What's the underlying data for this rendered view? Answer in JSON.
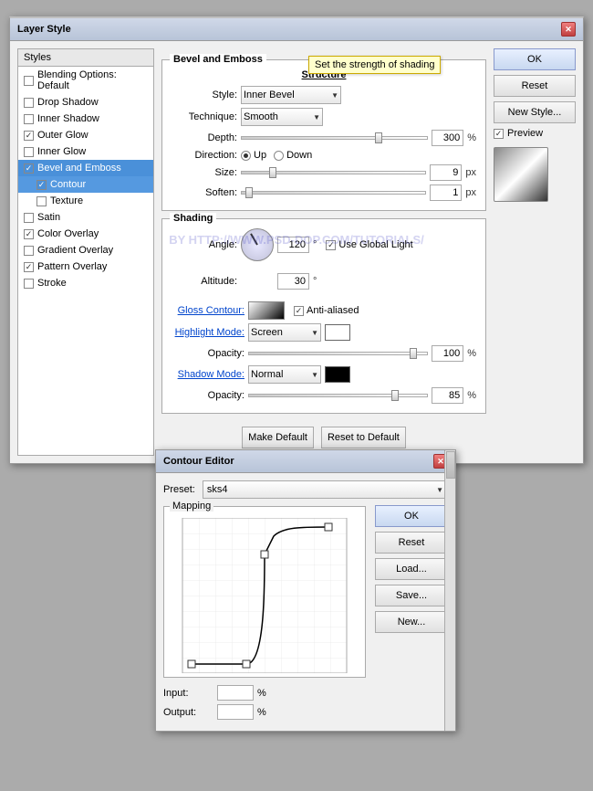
{
  "layerStyleDialog": {
    "title": "Layer Style",
    "leftPanel": {
      "header": "Styles",
      "items": [
        {
          "label": "Blending Options: Default",
          "checked": false,
          "active": false,
          "sub": false
        },
        {
          "label": "Drop Shadow",
          "checked": false,
          "active": false,
          "sub": false
        },
        {
          "label": "Inner Shadow",
          "checked": false,
          "active": false,
          "sub": false
        },
        {
          "label": "Outer Glow",
          "checked": true,
          "active": false,
          "sub": false
        },
        {
          "label": "Inner Glow",
          "checked": false,
          "active": false,
          "sub": false
        },
        {
          "label": "Bevel and Emboss",
          "checked": true,
          "active": true,
          "sub": false
        },
        {
          "label": "Contour",
          "checked": true,
          "active": true,
          "sub": true
        },
        {
          "label": "Texture",
          "checked": false,
          "active": false,
          "sub": true
        },
        {
          "label": "Satin",
          "checked": false,
          "active": false,
          "sub": false
        },
        {
          "label": "Color Overlay",
          "checked": true,
          "active": false,
          "sub": false
        },
        {
          "label": "Gradient Overlay",
          "checked": false,
          "active": false,
          "sub": false
        },
        {
          "label": "Pattern Overlay",
          "checked": true,
          "active": false,
          "sub": false
        },
        {
          "label": "Stroke",
          "checked": false,
          "active": false,
          "sub": false
        }
      ]
    },
    "structure": {
      "title": "Bevel and Emboss",
      "subtitle": "Structure",
      "styleLabel": "Style:",
      "styleValue": "Inner Bevel",
      "techniqueLabel": "Technique:",
      "techniqueValue": "Smooth",
      "depthLabel": "Depth:",
      "depthValue": "300",
      "depthUnit": "%",
      "directionLabel": "Direction:",
      "directionUp": "Up",
      "directionDown": "Down",
      "sizeLabel": "Size:",
      "sizeValue": "9",
      "sizeUnit": "px",
      "softenLabel": "Soften:",
      "softenValue": "1",
      "softenUnit": "px"
    },
    "shading": {
      "subtitle": "Shading",
      "angleLabel": "Angle:",
      "angleValue": "120",
      "angleDegree": "°",
      "useGlobalLight": "Use Global Light",
      "altitudeLabel": "Altitude:",
      "altitudeValue": "30",
      "altitudeDegree": "°",
      "glossContourLabel": "Gloss Contour:",
      "antiAliased": "Anti-aliased",
      "highlightModeLabel": "Highlight Mode:",
      "highlightModeValue": "Screen",
      "highlightOpacityLabel": "Opacity:",
      "highlightOpacityValue": "100",
      "highlightOpacityUnit": "%",
      "shadowModeLabel": "Shadow Mode:",
      "shadowModeValue": "Normal",
      "shadowOpacityLabel": "Opacity:",
      "shadowOpacityValue": "85",
      "shadowOpacityUnit": "%"
    },
    "buttons": {
      "makeDefault": "Make Default",
      "resetToDefault": "Reset to Default"
    },
    "rightPanel": {
      "ok": "OK",
      "reset": "Reset",
      "newStyle": "New Style...",
      "previewLabel": "Preview"
    },
    "tooltip": "Set the strength of shading"
  },
  "contourEditor": {
    "title": "Contour Editor",
    "presetLabel": "Preset:",
    "presetValue": "sks4",
    "mappingTitle": "Mapping",
    "inputLabel": "Input:",
    "inputValue": "",
    "inputUnit": "%",
    "outputLabel": "Output:",
    "outputValue": "",
    "outputUnit": "%",
    "buttons": {
      "ok": "OK",
      "reset": "Reset",
      "load": "Load...",
      "save": "Save...",
      "new": "New..."
    }
  },
  "watermark": "BY HTTP://WWW.PSD-DOP.COM/TUTORIALS/"
}
